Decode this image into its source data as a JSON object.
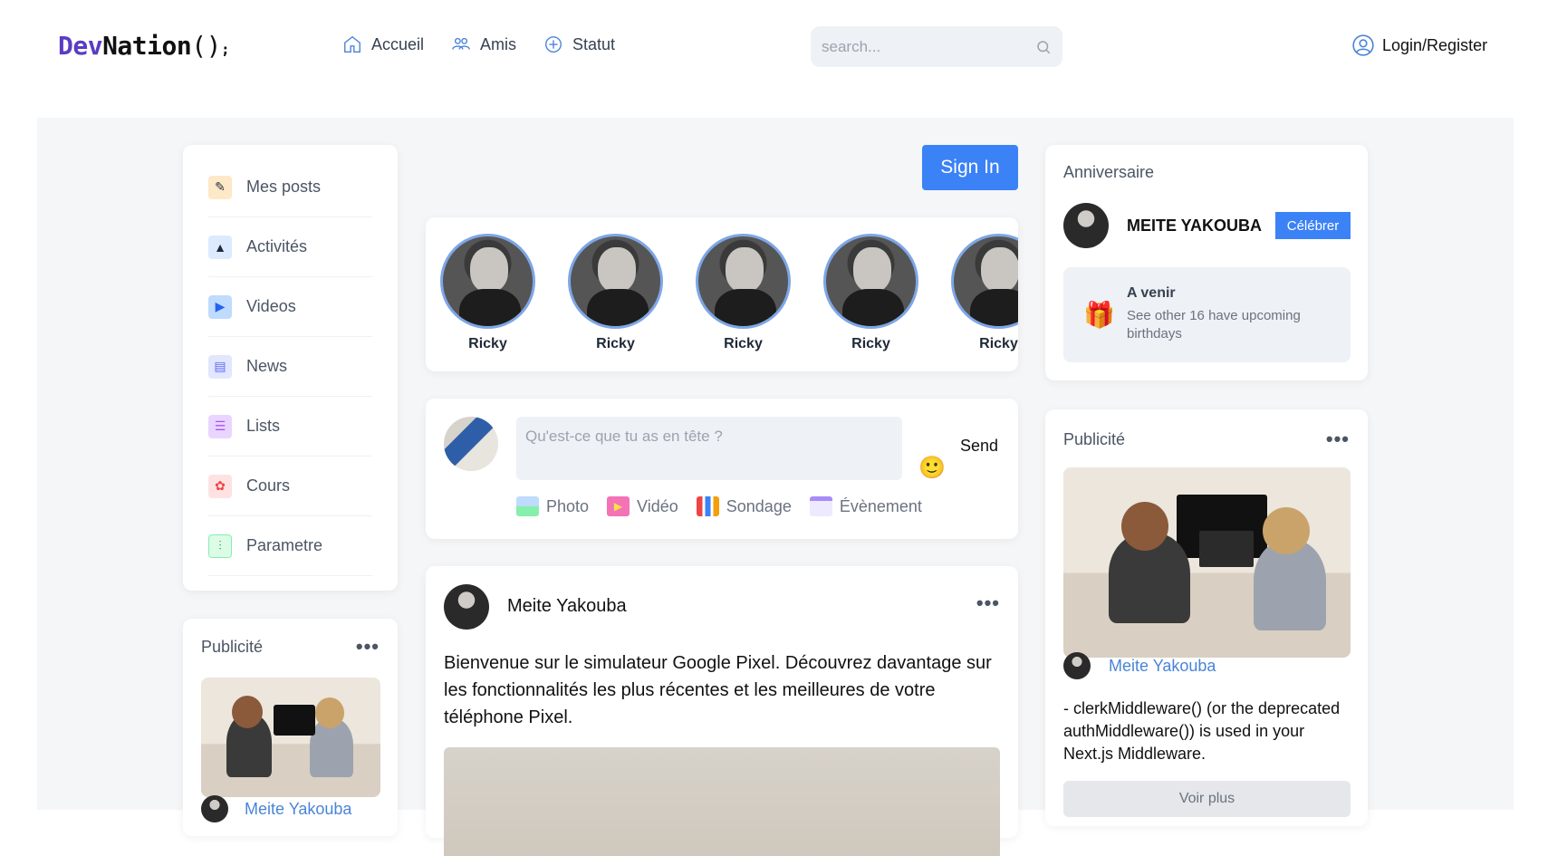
{
  "header": {
    "logo": {
      "dev": "Dev",
      "nation": "Nation",
      "parens": "()",
      "semi": ";"
    },
    "nav": [
      {
        "label": "Accueil",
        "icon": "home-icon"
      },
      {
        "label": "Amis",
        "icon": "users-icon"
      },
      {
        "label": "Statut",
        "icon": "plus-circle-icon"
      }
    ],
    "search_placeholder": "search...",
    "login_label": "Login/Register"
  },
  "sidebar": {
    "items": [
      {
        "label": "Mes posts",
        "icon": "posts-icon",
        "color": "#f59e0b"
      },
      {
        "label": "Activités",
        "icon": "activities-icon",
        "color": "#60a5fa"
      },
      {
        "label": "Videos",
        "icon": "videos-icon",
        "color": "#3b82f6"
      },
      {
        "label": "News",
        "icon": "news-icon",
        "color": "#6366f1"
      },
      {
        "label": "Lists",
        "icon": "lists-icon",
        "color": "#a855f7"
      },
      {
        "label": "Cours",
        "icon": "courses-icon",
        "color": "#ef4444"
      },
      {
        "label": "Parametre",
        "icon": "settings-icon",
        "color": "#22c55e"
      }
    ]
  },
  "pub_left": {
    "title": "Publicité",
    "author": "Meite Yakouba"
  },
  "signin_label": "Sign In",
  "stories": [
    {
      "name": "Ricky"
    },
    {
      "name": "Ricky"
    },
    {
      "name": "Ricky"
    },
    {
      "name": "Ricky"
    },
    {
      "name": "Ricky"
    }
  ],
  "composer": {
    "placeholder": "Qu'est-ce que tu as en tête ?",
    "send_label": "Send",
    "actions": [
      {
        "label": "Photo",
        "icon": "photo-icon",
        "color": "#86efac"
      },
      {
        "label": "Vidéo",
        "icon": "video-icon",
        "color": "#f472b6"
      },
      {
        "label": "Sondage",
        "icon": "poll-icon",
        "color": "#f59e0b"
      },
      {
        "label": "Évènement",
        "icon": "calendar-icon",
        "color": "#a78bfa"
      }
    ]
  },
  "post": {
    "author": "Meite Yakouba",
    "text": "Bienvenue sur le simulateur Google Pixel. Découvrez davantage sur les fonctionnalités les plus récentes et les meilleures de votre téléphone Pixel."
  },
  "birthday": {
    "title": "Anniversaire",
    "name": "MEITE YAKOUBA",
    "celebrate_label": "Célébrer",
    "upcoming_title": "A venir",
    "upcoming_sub": "See other 16 have upcoming birthdays"
  },
  "pub_right": {
    "title": "Publicité",
    "author": "Meite Yakouba",
    "text": "- clerkMiddleware() (or the deprecated authMiddleware()) is used in your Next.js Middleware.",
    "voir_label": "Voir plus"
  }
}
